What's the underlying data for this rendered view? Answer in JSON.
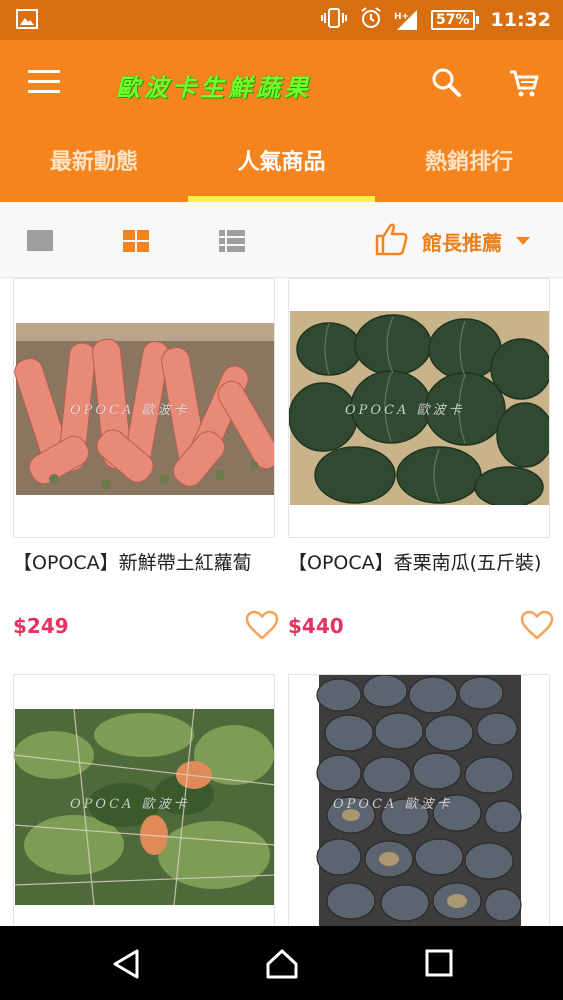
{
  "status_bar": {
    "network_label": "H+",
    "battery": "57%",
    "time": "11:32"
  },
  "app_bar": {
    "brand": "歐波卡生鮮蔬果"
  },
  "tabs": [
    {
      "label": "最新動態"
    },
    {
      "label": "人氣商品"
    },
    {
      "label": "熱銷排行"
    }
  ],
  "toolbar": {
    "sort_label": "館長推薦"
  },
  "products": [
    {
      "name": "【OPOCA】新鮮帶土紅蘿蔔",
      "price": "$249",
      "watermark": "OPOCA 歐波卡"
    },
    {
      "name": "【OPOCA】香栗南瓜(五斤裝)",
      "price": "$440",
      "watermark": "OPOCA 歐波卡"
    },
    {
      "name": "",
      "price": "",
      "watermark": "OPOCA 歐波卡"
    },
    {
      "name": "",
      "price": "",
      "watermark": "OPOCA 歐波卡"
    }
  ],
  "colors": {
    "primary": "#f5841f",
    "status_bar": "#d86f10",
    "tab_indicator": "#fff34a",
    "price": "#e5325e",
    "heart": "#f5a25a"
  },
  "icons": [
    "gallery-icon",
    "vibrate-icon",
    "alarm-icon",
    "signal-icon",
    "battery-icon",
    "menu-icon",
    "search-icon",
    "cart-icon",
    "single-view-icon",
    "grid-view-icon",
    "list-view-icon",
    "thumbs-up-icon",
    "heart-icon",
    "back-icon",
    "home-icon",
    "recents-icon"
  ]
}
